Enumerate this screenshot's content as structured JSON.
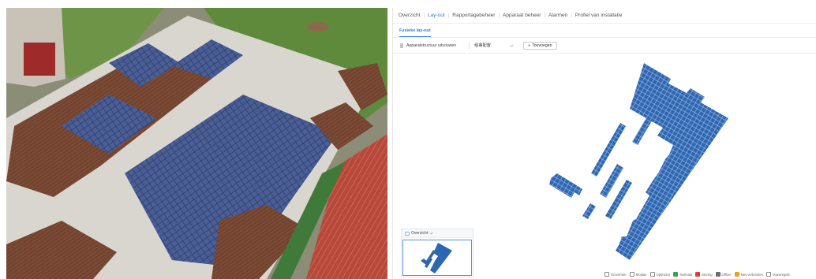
{
  "nav": {
    "items": [
      "Overzicht",
      "Lay-out",
      "Rapportagebeheer",
      "Apparaat beheer",
      "Alarmen",
      "Profiel van installatie"
    ],
    "active": "Lay-out"
  },
  "subtab": {
    "label": "Fysieke lay-out"
  },
  "toolbar": {
    "expand_label": "Apparatstructuur uitvouwen",
    "select_value": "组串配置",
    "add_label": "Toevoegen",
    "add_icon": "plus-icon"
  },
  "overview": {
    "label": "Overzicht",
    "chevron": "chevron-down-icon"
  },
  "legend": {
    "items": [
      {
        "label": "Omvormer",
        "color": "#9aa0a6",
        "icon": "inverter-icon"
      },
      {
        "label": "Module",
        "color": "#9aa0a6",
        "icon": "module-icon"
      },
      {
        "label": "Optimizer",
        "color": "#9aa0a6",
        "icon": "optimizer-icon"
      },
      {
        "label": "Normaal",
        "color": "#2fa84f",
        "icon": "status-normal-icon"
      },
      {
        "label": "Storing",
        "color": "#e5383b",
        "icon": "status-fault-icon"
      },
      {
        "label": "Offline",
        "color": "#6b6f75",
        "icon": "status-offline-icon"
      },
      {
        "label": "Niet verbonden",
        "color": "#f0a020",
        "icon": "status-disconnected-icon"
      },
      {
        "label": "Vouwregels",
        "color": "#9aa0a6",
        "icon": "fold-rules-icon"
      }
    ]
  },
  "colors": {
    "accent": "#2f7ce8",
    "panel": "#2e67b1",
    "panel_line": "#9fbde6"
  }
}
